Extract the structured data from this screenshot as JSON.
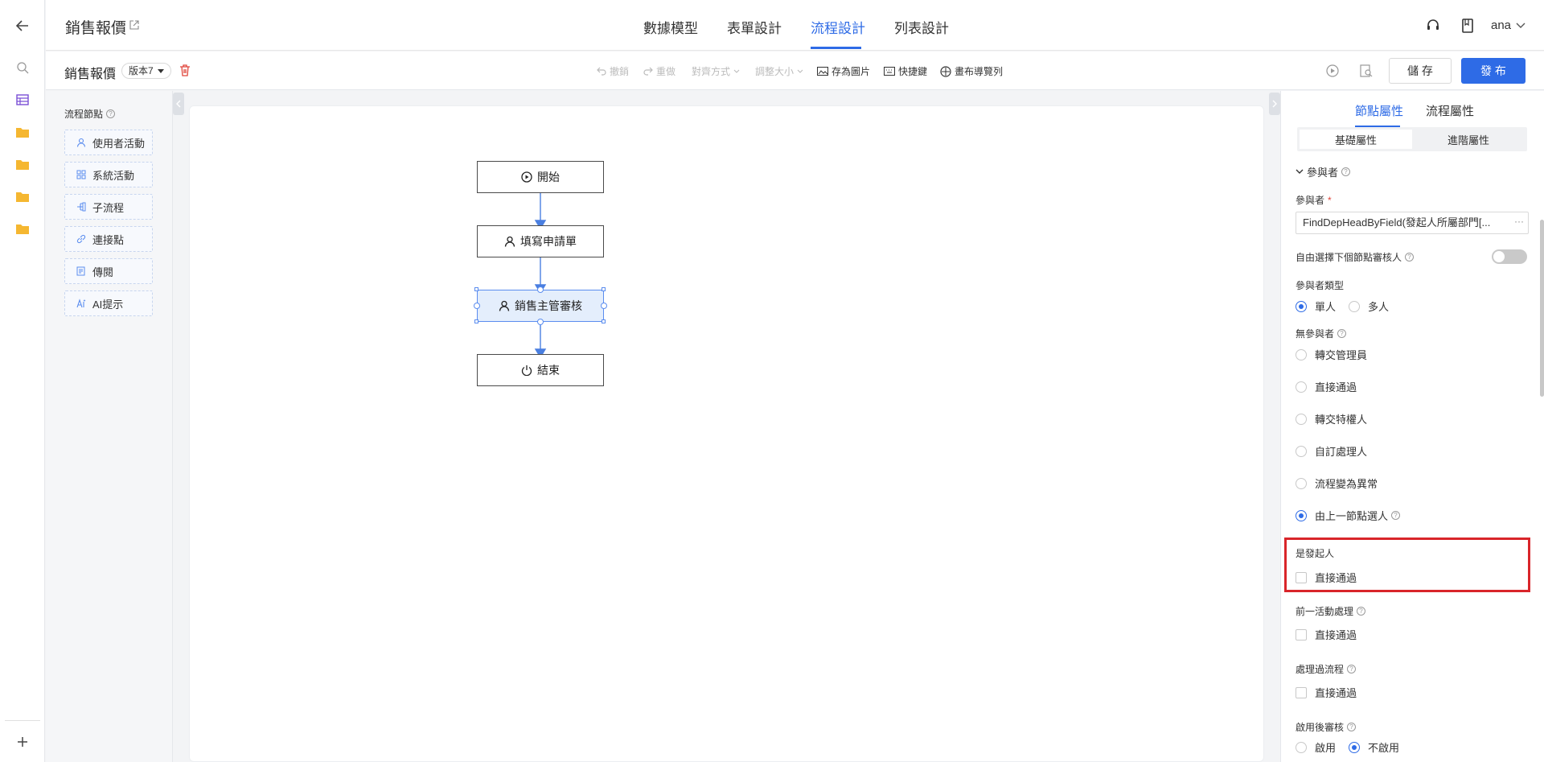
{
  "app": {
    "title": "銷售報價"
  },
  "nav_tabs": [
    {
      "label": "數據模型",
      "active": false
    },
    {
      "label": "表單設計",
      "active": false
    },
    {
      "label": "流程設計",
      "active": true
    },
    {
      "label": "列表設計",
      "active": false
    }
  ],
  "user": {
    "name": "ana"
  },
  "toolbar": {
    "form_name": "銷售報價",
    "version": "版本7",
    "undo": "撤銷",
    "redo": "重做",
    "align": "對齊方式",
    "resize": "調整大小",
    "save_image": "存為圖片",
    "shortcuts": "快捷鍵",
    "canvas_nav": "畫布導覽列",
    "save_label": "儲 存",
    "publish_label": "發 布"
  },
  "palette": {
    "title": "流程節點",
    "items": [
      {
        "label": "使用者活動",
        "icon": "user-icon"
      },
      {
        "label": "系統活動",
        "icon": "grid-icon"
      },
      {
        "label": "子流程",
        "icon": "subflow-icon"
      },
      {
        "label": "連接點",
        "icon": "link-icon"
      },
      {
        "label": "傳閱",
        "icon": "document-icon"
      },
      {
        "label": "AI提示",
        "icon": "ai-icon"
      }
    ]
  },
  "flow": {
    "nodes": [
      {
        "label": "開始",
        "icon": "play-circle-icon"
      },
      {
        "label": "填寫申請單",
        "icon": "user-icon"
      },
      {
        "label": "銷售主管審核",
        "icon": "user-icon",
        "selected": true
      },
      {
        "label": "結束",
        "icon": "power-icon"
      }
    ]
  },
  "panel": {
    "tabs": [
      {
        "label": "節點屬性",
        "active": true
      },
      {
        "label": "流程屬性",
        "active": false
      }
    ],
    "sub_tabs": [
      {
        "label": "基礎屬性",
        "active": true
      },
      {
        "label": "進階屬性",
        "active": false
      }
    ],
    "section_title": "參與者",
    "participant_label": "參與者",
    "participant_value": "FindDepHeadByField(發起人所屬部門[...",
    "free_select_label": "自由選擇下個節點審核人",
    "free_select_enabled": false,
    "participant_type_label": "參與者類型",
    "participant_type_options": [
      {
        "label": "單人",
        "checked": true
      },
      {
        "label": "多人",
        "checked": false
      }
    ],
    "no_participant_label": "無參與者",
    "no_participant_options": [
      {
        "label": "轉交管理員",
        "checked": false
      },
      {
        "label": "直接通過",
        "checked": false
      },
      {
        "label": "轉交特權人",
        "checked": false
      },
      {
        "label": "自訂處理人",
        "checked": false
      },
      {
        "label": "流程變為異常",
        "checked": false
      },
      {
        "label": "由上一節點選人",
        "checked": true
      }
    ],
    "is_initiator_label": "是發起人",
    "is_initiator_option": "直接通過",
    "prev_activity_label": "前一活動處理",
    "prev_activity_option": "直接通過",
    "processed_label": "處理過流程",
    "processed_option": "直接通過",
    "post_review_label": "啟用後審核",
    "post_review_options": [
      {
        "label": "啟用",
        "checked": false
      },
      {
        "label": "不啟用",
        "checked": true
      }
    ]
  },
  "colors": {
    "accent": "#2e6be6",
    "highlight": "#d9252a"
  }
}
